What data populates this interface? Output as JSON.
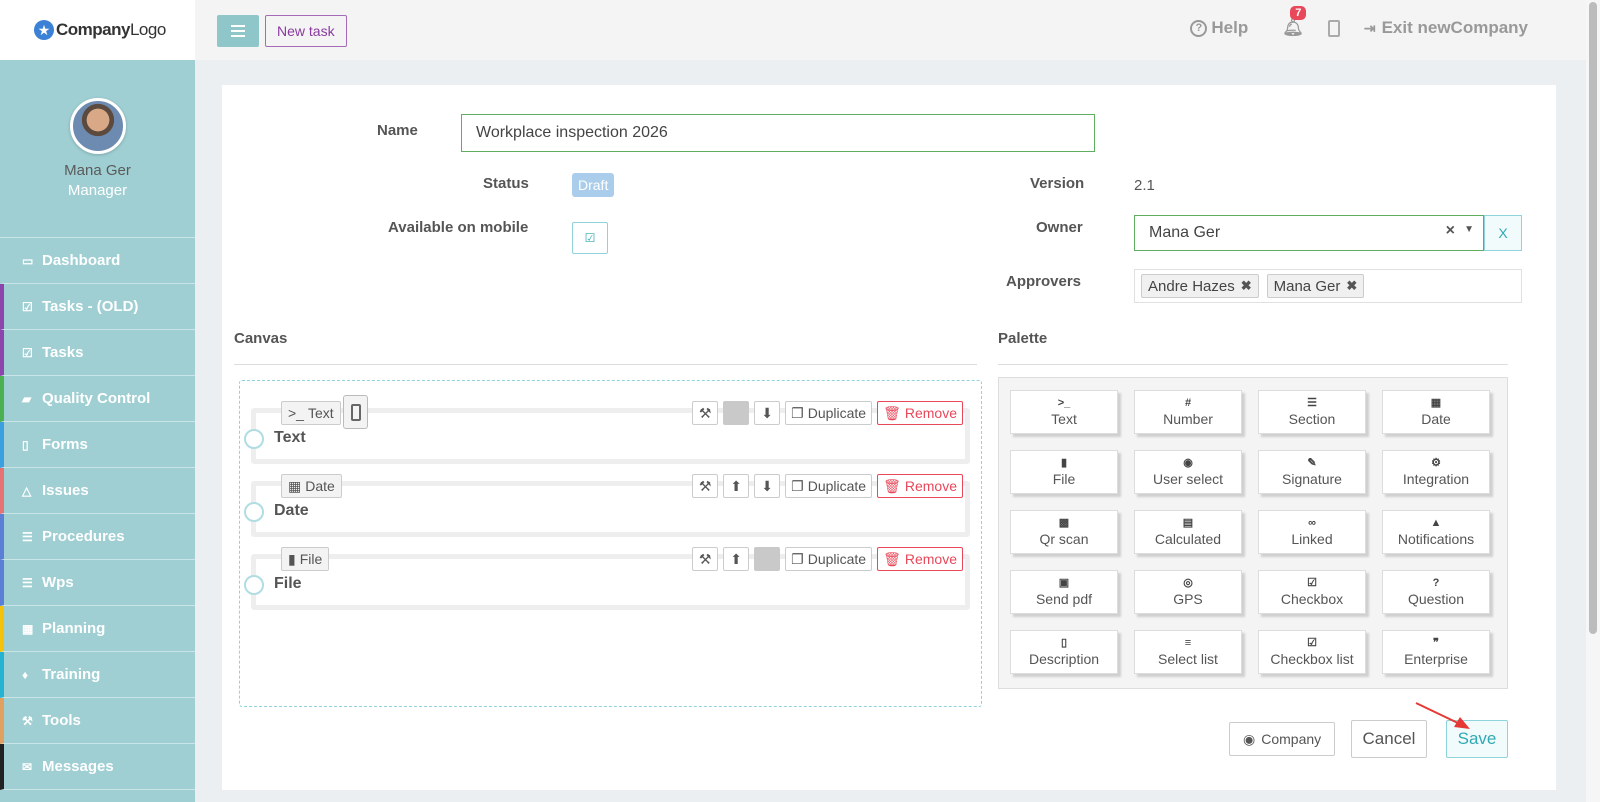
{
  "logo": {
    "bold": "Company",
    "lite": "Logo"
  },
  "user": {
    "name": "Mana Ger",
    "role": "Manager"
  },
  "sidebar": {
    "items": [
      {
        "label": "Dashboard",
        "icon": "monitor-icon",
        "accent": "#9fcfd3"
      },
      {
        "label": "Tasks - (OLD)",
        "icon": "check-square-icon",
        "accent": "#8e44ad"
      },
      {
        "label": "Tasks",
        "icon": "check-square-icon",
        "accent": "#8e44ad"
      },
      {
        "label": "Quality Control",
        "icon": "book-icon",
        "accent": "#4caf50"
      },
      {
        "label": "Forms",
        "icon": "file-icon",
        "accent": "#3aa0e0"
      },
      {
        "label": "Issues",
        "icon": "bell-icon",
        "accent": "#e57373"
      },
      {
        "label": "Procedures",
        "icon": "list-icon",
        "accent": "#5b7fd6"
      },
      {
        "label": "Wps",
        "icon": "list-icon",
        "accent": "#5b7fd6"
      },
      {
        "label": "Planning",
        "icon": "calendar-icon",
        "accent": "#f4c20d"
      },
      {
        "label": "Training",
        "icon": "graduation-icon",
        "accent": "#26b3d1"
      },
      {
        "label": "Tools",
        "icon": "wrench-icon",
        "accent": "#e0a060"
      },
      {
        "label": "Messages",
        "icon": "envelope-icon",
        "accent": "#222222"
      }
    ]
  },
  "topbar": {
    "new_task": "New task",
    "help": "Help",
    "notifications": "7",
    "exit": "Exit newCompany"
  },
  "form": {
    "name_label": "Name",
    "name_value": "Workplace inspection 2026",
    "status_label": "Status",
    "status_value": "Draft",
    "mobile_label": "Available on mobile",
    "version_label": "Version",
    "version_value": "2.1",
    "owner_label": "Owner",
    "owner_value": "Mana Ger",
    "owner_x": "X",
    "approvers_label": "Approvers",
    "approvers": [
      "Andre Hazes",
      "Mana Ger"
    ]
  },
  "canvas": {
    "title": "Canvas",
    "fields": [
      {
        "tag": "Text",
        "title": "Text",
        "tag_icon": "terminal-icon"
      },
      {
        "tag": "Date",
        "title": "Date",
        "tag_icon": "calendar-icon"
      },
      {
        "tag": "File",
        "title": "File",
        "tag_icon": "file-icon"
      }
    ],
    "duplicate": "Duplicate",
    "remove": "Remove"
  },
  "palette": {
    "title": "Palette",
    "items": [
      {
        "label": "Text",
        "icon": ">_"
      },
      {
        "label": "Number",
        "icon": "#"
      },
      {
        "label": "Section",
        "icon": "☰"
      },
      {
        "label": "Date",
        "icon": "▦"
      },
      {
        "label": "File",
        "icon": "▮"
      },
      {
        "label": "User select",
        "icon": "◉"
      },
      {
        "label": "Signature",
        "icon": "✎"
      },
      {
        "label": "Integration",
        "icon": "⚙"
      },
      {
        "label": "Qr scan",
        "icon": "▩"
      },
      {
        "label": "Calculated",
        "icon": "▤"
      },
      {
        "label": "Linked",
        "icon": "∞"
      },
      {
        "label": "Notifications",
        "icon": "▲"
      },
      {
        "label": "Send pdf",
        "icon": "▣"
      },
      {
        "label": "GPS",
        "icon": "◎"
      },
      {
        "label": "Checkbox",
        "icon": "☑"
      },
      {
        "label": "Question",
        "icon": "?"
      },
      {
        "label": "Description",
        "icon": "▯"
      },
      {
        "label": "Select list",
        "icon": "≡"
      },
      {
        "label": "Checkbox list",
        "icon": "☑"
      },
      {
        "label": "Enterprise",
        "icon": "❞"
      }
    ]
  },
  "footer": {
    "company": "Company",
    "cancel": "Cancel",
    "save": "Save"
  }
}
